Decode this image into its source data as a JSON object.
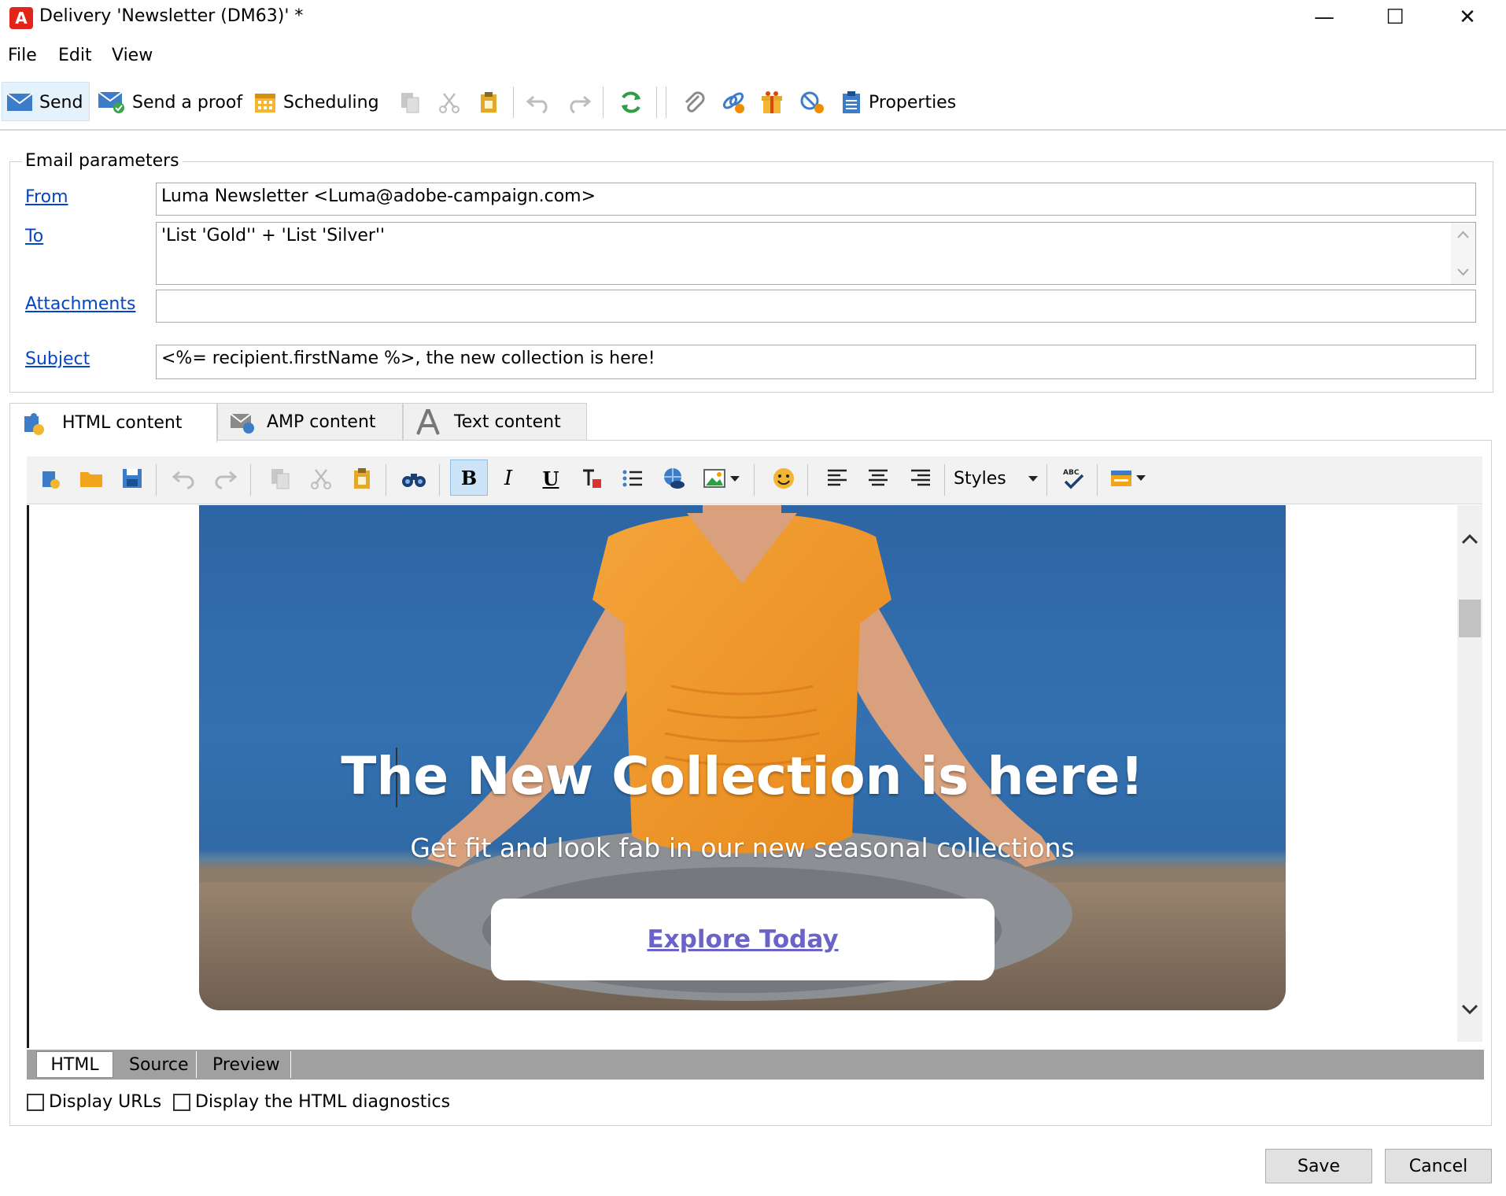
{
  "window": {
    "title": "Delivery 'Newsletter (DM63)' *",
    "logo_letter": "A",
    "minimize": "—",
    "maximize": "☐",
    "close": "✕"
  },
  "menu": [
    "File",
    "Edit",
    "View"
  ],
  "toolbar": {
    "send": "Send",
    "send_proof": "Send a proof",
    "scheduling": "Scheduling",
    "properties": "Properties"
  },
  "email_params": {
    "legend": "Email parameters",
    "from_label": "From",
    "from_value": "Luma Newsletter <Luma@adobe-campaign.com>",
    "to_label": "To",
    "to_value": "'List 'Gold'' + 'List 'Silver''",
    "attachments_label": "Attachments",
    "attachments_value": "",
    "subject_label": "Subject",
    "subject_value": "<%= recipient.firstName %>, the new collection is here!"
  },
  "content_tabs": [
    "HTML content",
    "AMP content",
    "Text content"
  ],
  "editor": {
    "styles_label": "Styles"
  },
  "email_preview": {
    "hero_title": "The New Collection is here!",
    "hero_subtitle": "Get fit and look fab in our new seasonal collections",
    "cta": "Explore Today"
  },
  "mode_tabs": [
    "HTML",
    "Source",
    "Preview"
  ],
  "options": {
    "display_urls": "Display URLs",
    "display_diagnostics": "Display the HTML diagnostics"
  },
  "buttons": {
    "save": "Save",
    "cancel": "Cancel"
  },
  "colors": {
    "accent": "#0645c4",
    "cta_link": "#6a63c9",
    "logo": "#e1251b"
  }
}
